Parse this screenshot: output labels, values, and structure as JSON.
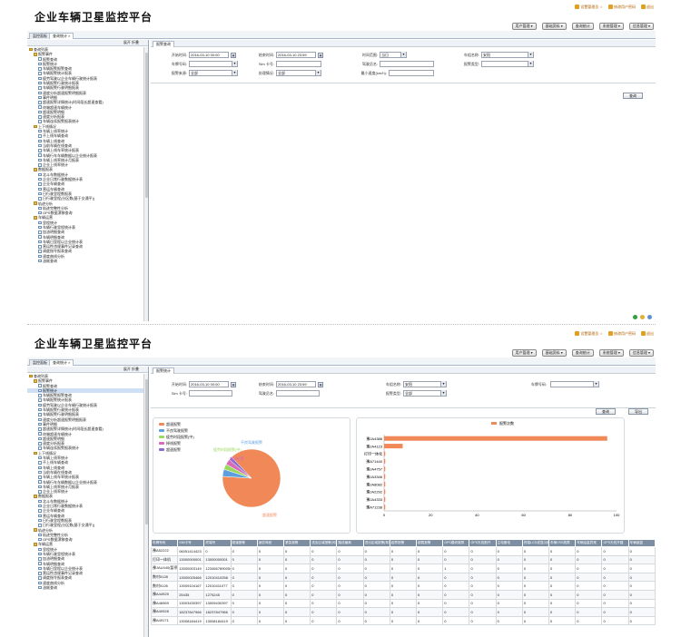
{
  "header": {
    "title": "企业车辆卫星监控平台",
    "links": [
      "设置管理员 ☆",
      "修改用户密码",
      "退出"
    ],
    "menus": [
      "用户管理 ▾",
      "基础资料 ▾",
      "查询统计",
      "系统管理 ▾",
      "信息管理 ▾"
    ]
  },
  "tabs": [
    "监控面板",
    "查询统计 ×"
  ],
  "sidebar": {
    "head": "展开  折叠",
    "tree": [
      {
        "label": "查询列表",
        "type": "folder",
        "level": 0
      },
      {
        "label": "报警事件",
        "type": "folder",
        "level": 1
      },
      {
        "label": "报警查询",
        "type": "doc",
        "level": 2
      },
      {
        "label": "报警统计",
        "type": "doc",
        "level": 2
      },
      {
        "label": "车辆报警报警查询",
        "type": "doc",
        "level": 2
      },
      {
        "label": "车辆报警统计报表",
        "type": "doc",
        "level": 2
      },
      {
        "label": "疲劳驾驶以企业车辆行驶统计报表",
        "type": "doc",
        "level": 2
      },
      {
        "label": "车辆报警行驶统计报表",
        "type": "doc",
        "level": 2
      },
      {
        "label": "车辆报警行驶明细报表",
        "type": "doc",
        "level": 2
      },
      {
        "label": "速度分析超速报警明细报表",
        "type": "doc",
        "level": 2
      },
      {
        "label": "事件明细",
        "type": "doc",
        "level": 2
      },
      {
        "label": "超速报警详情统计(时间段长超速查看)",
        "type": "doc",
        "level": 2
      },
      {
        "label": "终端超速车辆统计",
        "type": "doc",
        "level": 2
      },
      {
        "label": "超速报警明细",
        "type": "doc",
        "level": 2
      },
      {
        "label": "速度分析报表",
        "type": "doc",
        "level": 2
      },
      {
        "label": "车辆连续报警报表统计",
        "type": "doc",
        "level": 2
      },
      {
        "label": "上下线情况",
        "type": "folder",
        "level": 1
      },
      {
        "label": "车辆上线率统计",
        "type": "doc",
        "level": 2
      },
      {
        "label": "不上线车辆查询",
        "type": "doc",
        "level": 2
      },
      {
        "label": "车辆上线查询",
        "type": "doc",
        "level": 2
      },
      {
        "label": "当前车辆在线查询",
        "type": "doc",
        "level": 2
      },
      {
        "label": "车辆上线车率统计报表",
        "type": "doc",
        "level": 2
      },
      {
        "label": "车辆行车车辆数据以企业统计报表",
        "type": "doc",
        "level": 2
      },
      {
        "label": "车辆上线率统计月报表",
        "type": "doc",
        "level": 2
      },
      {
        "label": "企业上线率统计",
        "type": "doc",
        "level": 2
      },
      {
        "label": "数据报表",
        "type": "folder",
        "level": 1
      },
      {
        "label": "北斗车数据统计",
        "type": "doc",
        "level": 2
      },
      {
        "label": "企业日常行驶数据统计表",
        "type": "doc",
        "level": 2
      },
      {
        "label": "企业车辆查询",
        "type": "doc",
        "level": 2
      },
      {
        "label": "营运车辆查询",
        "type": "doc",
        "level": 2
      },
      {
        "label": "日行驶里程数报表",
        "type": "doc",
        "level": 2
      },
      {
        "label": "日行驶里程(分区数(基于交通平))",
        "type": "doc",
        "level": 2
      },
      {
        "label": "轨迹分析",
        "type": "folder",
        "level": 1
      },
      {
        "label": "轨迹完整性分析",
        "type": "doc",
        "level": 2
      },
      {
        "label": "GPS数据漂移查询",
        "type": "doc",
        "level": 2
      },
      {
        "label": "车辆运营",
        "type": "folder",
        "level": 1
      },
      {
        "label": "里程统计",
        "type": "doc",
        "level": 2
      },
      {
        "label": "车辆行驶里程统计表",
        "type": "doc",
        "level": 2
      },
      {
        "label": "加油明细查询",
        "type": "doc",
        "level": 2
      },
      {
        "label": "车辆明细查询",
        "type": "doc",
        "level": 2
      },
      {
        "label": "车辆日里程以企业统计表",
        "type": "doc",
        "level": 2
      },
      {
        "label": "营运性违规事件记录查询",
        "type": "doc",
        "level": 2
      },
      {
        "label": "调度指令报表查询",
        "type": "doc",
        "level": 2
      },
      {
        "label": "速度曲线分析",
        "type": "doc",
        "level": 2
      },
      {
        "label": "油耗查询",
        "type": "doc",
        "level": 2
      }
    ]
  },
  "top_main": {
    "tab": "报警查询",
    "fields": {
      "start_label": "开始时间:",
      "start_value": "2016-03-10 00:00",
      "end_label": "结束时间:",
      "end_value": "2016-03-10 23:59",
      "range_label": "时间范围:",
      "range_value": "当日",
      "company_label": "车组名称:",
      "company_value": "安阳",
      "plate_label": "车牌号码:",
      "plate_value": "",
      "sim_label": "Sim 卡号:",
      "sim_value": "",
      "driver_label": "驾驶员名:",
      "driver_value": "",
      "alarmtype_label": "报警类型:",
      "alarmtype_value": "",
      "source_label": "报警来源:",
      "source_value": "全部",
      "handle_label": "处理情况:",
      "handle_value": "全部",
      "speed_label": "最小速度(km/h):",
      "speed_value": ""
    },
    "btn_query": "查询",
    "btn_export": "导出"
  },
  "bottom_main": {
    "tab": "报警统计",
    "fields": {
      "start_label": "开始时间:",
      "start_value": "2016-03-10 00:00",
      "end_label": "结束时间:",
      "end_value": "2016-03-10 23:59",
      "company_label": "车组名称:",
      "company_value": "安阳",
      "plate_label": "车牌号码:",
      "plate_value": "",
      "sim_label": "Sim 卡号:",
      "sim_value": "",
      "driver_label": "驾驶员名:",
      "driver_value": "",
      "alarmtype_label": "报警类型:",
      "alarmtype_value": "全部"
    },
    "btn_query": "查询",
    "btn_export": "导出",
    "selected_tree_index": 3
  },
  "chart_data": [
    {
      "type": "pie",
      "title": "",
      "legend": [
        "超速报警",
        "不良驾驶报警",
        "疲劳时段报警(中)",
        "掉线报警",
        "超速报警"
      ],
      "labels": [
        "超速报警",
        "不良驾驶报警",
        "疲劳时段报警(中)",
        "超速报警"
      ],
      "values": [
        88,
        4,
        3,
        3,
        2
      ],
      "colors": [
        "#f08858",
        "#5da0e0",
        "#9bd860",
        "#d86ab8",
        "#8c6cd0"
      ]
    },
    {
      "type": "bar",
      "orientation": "horizontal",
      "legend": [
        "报警次数"
      ],
      "categories": [
        "豫JA4386",
        "豫JA4123",
        "打印一体化",
        "豫A71440",
        "豫JA4757",
        "豫JA3346",
        "豫JA8082",
        "豫JA2292",
        "豫JA4333",
        "豫A71238"
      ],
      "values": [
        96,
        8,
        0.5,
        0.5,
        0.5,
        0.5,
        0.5,
        0.5,
        0.5,
        0.5
      ],
      "xlim": [
        0,
        100
      ],
      "xticks": [
        0,
        20,
        40,
        60,
        80,
        100
      ],
      "color": "#f08858"
    }
  ],
  "table": {
    "headers": [
      "车牌号码",
      "SIM卡号",
      "终端号",
      "超速报警",
      "疲劳驾驶",
      "紧急报警",
      "进出区域报警(司机)",
      "路线偏离",
      "进出区域报警(驾驶员)",
      "越界报警",
      "超载报警",
      "GPS模块故障",
      "GPS天线断开",
      "主电断电",
      "终端LCD或显示器故障",
      "车辆VSS故障",
      "车辆油量异常",
      "GPS天线开路",
      "车辆被盗"
    ],
    "rows": [
      [
        "豫A52222",
        "06051414423",
        "0",
        "0",
        "0",
        "0",
        "0",
        "0",
        "0",
        "0",
        "0",
        "0",
        "0",
        "0",
        "0",
        "0",
        "0",
        "0",
        "0"
      ],
      [
        "打印一体机",
        "13000000001",
        "13000000001",
        "0",
        "0",
        "0",
        "0",
        "0",
        "0",
        "0",
        "0",
        "0",
        "0",
        "0",
        "0",
        "0",
        "0",
        "0",
        "0"
      ],
      [
        "豫JAU440(暂停)",
        "13000003149",
        "1234567890054",
        "0",
        "0",
        "0",
        "0",
        "0",
        "0",
        "0",
        "0",
        "1",
        "0",
        "0",
        "0",
        "0",
        "0",
        "0",
        "0"
      ],
      [
        "数村5128",
        "13000025466",
        "12010410258",
        "0",
        "0",
        "0",
        "0",
        "0",
        "0",
        "0",
        "0",
        "0",
        "0",
        "0",
        "0",
        "0",
        "0",
        "0",
        "0"
      ],
      [
        "数村5126",
        "13009104167",
        "12010411077",
        "0",
        "0",
        "0",
        "0",
        "0",
        "0",
        "0",
        "0",
        "0",
        "0",
        "0",
        "0",
        "0",
        "0",
        "0",
        "0"
      ],
      [
        "豫A44925",
        "25435",
        "1275245",
        "0",
        "0",
        "0",
        "0",
        "0",
        "0",
        "0",
        "0",
        "0",
        "0",
        "0",
        "0",
        "0",
        "0",
        "0",
        "0"
      ],
      [
        "豫A46969",
        "13003430397",
        "13009430397",
        "0",
        "0",
        "0",
        "0",
        "0",
        "0",
        "0",
        "0",
        "0",
        "0",
        "0",
        "0",
        "0",
        "0",
        "0",
        "0"
      ],
      [
        "豫A40928",
        "18237847966",
        "18237847966",
        "0",
        "0",
        "0",
        "0",
        "0",
        "0",
        "0",
        "0",
        "0",
        "0",
        "0",
        "0",
        "0",
        "0",
        "0",
        "0"
      ],
      [
        "豫A49171",
        "13008184419",
        "13008184419",
        "0",
        "0",
        "0",
        "0",
        "0",
        "0",
        "0",
        "0",
        "0",
        "0",
        "0",
        "0",
        "0",
        "0",
        "0",
        "0"
      ]
    ]
  }
}
